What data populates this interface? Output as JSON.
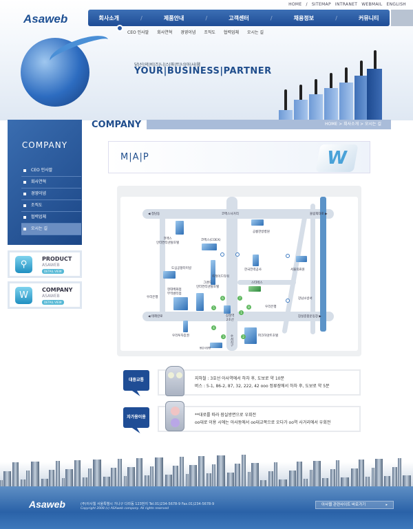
{
  "header": {
    "logo": "Asaweb",
    "util_links": [
      "HOME",
      "/",
      "SITEMAP",
      "INTRANET",
      "WEBMAIL",
      "ENGLISH"
    ],
    "gnb": [
      "회사소개",
      "/",
      "제품안내",
      "/",
      "고객센터",
      "/",
      "채용정보",
      "/",
      "커뮤니티"
    ],
    "sub_menu": [
      "CEO 인사말",
      "회사연혁",
      "경영이념",
      "조직도",
      "협력업체",
      "오시는 길"
    ]
  },
  "hero": {
    "slogan_ko": "당|신|의|비|즈|니|스|파|트|너|아|사|웹",
    "slogan": "YOUR|BUSINESS|PARTNER"
  },
  "page": {
    "title": "COMPANY",
    "breadcrumb": "HOME > 회사소개 > 오시는 길"
  },
  "sidebar": {
    "title": "COMPANY",
    "items": [
      "CEO 인사말",
      "회사연혁",
      "경영이념",
      "조직도",
      "협력업체",
      "오시는 길"
    ],
    "active": "오시는 길",
    "banners": [
      {
        "title": "PRODUCT",
        "sub": "ASAWEB",
        "btn": "DETAIL VIEW",
        "icon": "magnifier-icon"
      },
      {
        "title": "COMPANY",
        "sub": "ASAWEB",
        "btn": "DETAIL VIEW",
        "icon": "w-logo-icon"
      }
    ]
  },
  "map": {
    "title": "M|A|P",
    "labels": [
      "◀ 청담동",
      "코엑스사거리",
      "올림픽대로 ▶",
      "코엑스\n인터컨티넨탈호텔",
      "공릉한방병원",
      "코엑스(COEX)",
      "한국전력공사",
      "서울의료원",
      "도심공항터미널",
      "트레이드타워",
      "그랜드\n인터컨티넨탈호텔",
      "스타벅스",
      "현대백화점\n무역센터점",
      "우리은행",
      "우리은행",
      "강남소방서",
      "◀ 테헤란로",
      "삼성역\n2호선",
      "잠실종합운동장 ▶",
      "우리투자증권",
      "파크하얏트호텔",
      "봉은사방향",
      "수서지구"
    ],
    "exits": [
      "1",
      "2",
      "3",
      "4",
      "5",
      "6",
      "7",
      "8"
    ]
  },
  "directions": [
    {
      "tag": "대중교통",
      "icon": "subway-icon",
      "lines": [
        "지하철 : 3호선 아사역에서 하차 후, 도보로 약 10분",
        "버스 : 5-1, 86-2, 87, 32, 222, 42 ooo 정류장에서 하차 후, 도보로 약 5분"
      ]
    },
    {
      "tag": "자가용이용",
      "icon": "traffic-light-icon",
      "lines": [
        "**대로를 따라 잠실방면으로 우회전",
        "oo대로 이용 시에는 아사동에서 oo대교쪽으로 오다가 oo역 사거리에서 우회전"
      ]
    }
  ],
  "footer": {
    "logo": "Asaweb",
    "address": "(주)아사웹 서울특별시 가나구 다라동 123번지  Tel.01)234-5678-9  Fax.01)234-5678-9",
    "copyright": "Copyright 2008 (c) ASAweb company. All rights reserved",
    "family_site": "아사웹 관련사이트 바로가기"
  }
}
